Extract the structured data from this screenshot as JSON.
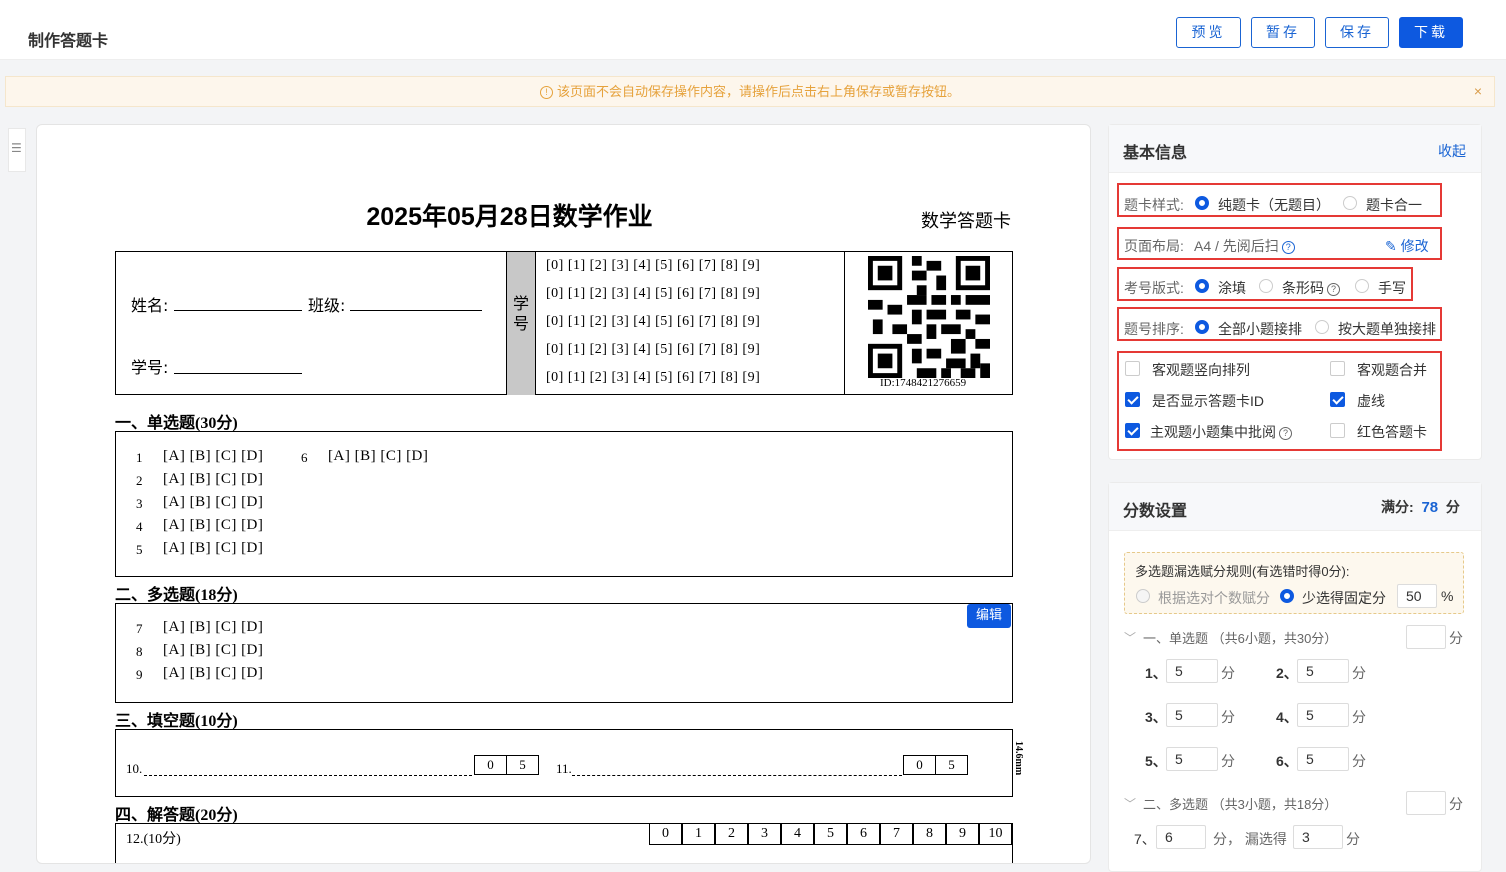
{
  "app": {
    "title": "制作答题卡"
  },
  "toolbar": {
    "preview": "预览",
    "temp_save": "暂存",
    "save": "保存",
    "download": "下载"
  },
  "notice": {
    "text": "该页面不会自动保存操作内容，请操作后点击右上角保存或暂存按钮。",
    "close": "×"
  },
  "sheet": {
    "title": "2025年05月28日数学作业",
    "subtitle": "数学答题卡",
    "name_label": "姓名:",
    "class_label": "班级:",
    "id_label": "学号:",
    "id_column": "学号",
    "digit_row": "[0] [1] [2] [3] [4] [5] [6] [7] [8] [9]",
    "qr_id": "ID:1748421276659",
    "sec1": "一、单选题(30分)",
    "sec2": "二、多选题(18分)",
    "sec3": "三、填空题(10分)",
    "sec4": "四、解答题(20分)",
    "options": "[A] [B] [C] [D]",
    "edit_btn": "编辑",
    "q10": "10.",
    "q11": "11.",
    "fill_scores": [
      "0",
      "5"
    ],
    "side_note": "14.6mm",
    "q12": "12.(10分)",
    "grades": [
      "0",
      "1",
      "2",
      "3",
      "4",
      "5",
      "6",
      "7",
      "8",
      "9",
      "10"
    ]
  },
  "basic": {
    "title": "基本信息",
    "collapse": "收起",
    "style_label": "题卡样式:",
    "style_opt1": "纯题卡（无题目）",
    "style_opt2": "题卡合一",
    "layout_label": "页面布局:",
    "layout_value": "A4 / 先阅后扫",
    "modify": "修改",
    "id_label": "考号版式:",
    "id_opt1": "涂填",
    "id_opt2": "条形码",
    "id_opt3": "手写",
    "order_label": "题号排序:",
    "order_opt1": "全部小题接排",
    "order_opt2": "按大题单独接排",
    "cb1": "客观题竖向排列",
    "cb2": "客观题合并",
    "cb3": "是否显示答题卡ID",
    "cb4": "虚线",
    "cb5": "主观题小题集中批阅",
    "cb6": "红色答题卡"
  },
  "score": {
    "title": "分数设置",
    "full_label": "满分:",
    "full_value": "78",
    "full_unit": "分",
    "rule_title": "多选题漏选赋分规则(有选错时得0分):",
    "rule_opt1": "根据选对个数赋分",
    "rule_opt2": "少选得固定分",
    "rule_value": "50",
    "rule_unit": "%",
    "group1": "一、单选题 （共6小题，共30分）",
    "group2": "二、多选题 （共3小题，共18分）",
    "unit": "分",
    "items": [
      {
        "n": "1、",
        "v": "5"
      },
      {
        "n": "2、",
        "v": "5"
      },
      {
        "n": "3、",
        "v": "5"
      },
      {
        "n": "4、",
        "v": "5"
      },
      {
        "n": "5、",
        "v": "5"
      },
      {
        "n": "6、",
        "v": "5"
      }
    ],
    "q7_label": "7、",
    "q7_value": "6",
    "miss_label": "分，  漏选得",
    "miss_value": "3"
  }
}
